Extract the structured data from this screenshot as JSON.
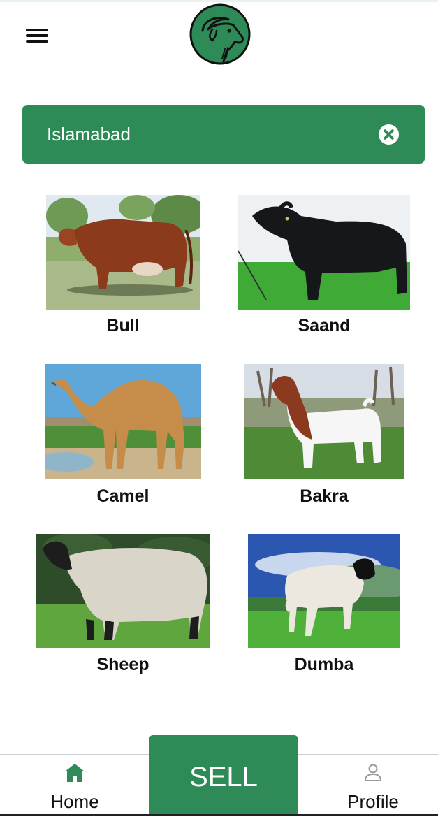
{
  "header": {
    "menu_icon": "hamburger-menu-icon",
    "logo_icon": "goat-head-logo"
  },
  "location": {
    "value": "Islamabad",
    "clear_icon": "close-circle-icon"
  },
  "categories": [
    {
      "label": "Bull"
    },
    {
      "label": "Saand"
    },
    {
      "label": "Camel"
    },
    {
      "label": "Bakra"
    },
    {
      "label": "Sheep"
    },
    {
      "label": "Dumba"
    }
  ],
  "bottom_nav": {
    "home": {
      "label": "Home",
      "icon": "home-icon"
    },
    "sell": {
      "label": "SELL"
    },
    "profile": {
      "label": "Profile",
      "icon": "user-icon"
    }
  },
  "colors": {
    "brand_green": "#2e8b57",
    "text_dark": "#111111",
    "icon_grey": "#9a9a9a"
  }
}
